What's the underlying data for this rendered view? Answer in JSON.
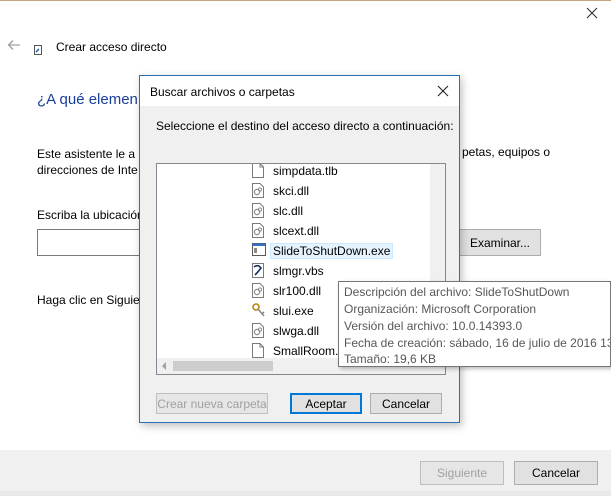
{
  "wizard": {
    "title": "Crear acceso directo",
    "heading": "¿A qué elemen",
    "description_line1": "Este asistente le a",
    "description_line1_right": "petas, equipos o",
    "description_line2": "direcciones de Inte",
    "location_label": "Escriba la ubicación",
    "location_value": "",
    "browse_button": "Examinar...",
    "hint": "Haga clic en Siguie",
    "next_button": "Siguiente",
    "cancel_button": "Cancelar"
  },
  "dialog": {
    "title": "Buscar archivos o carpetas",
    "instruction": "Seleccione el destino del acceso directo a continuación:",
    "items": [
      {
        "name": "simpdata.tlb",
        "icon": "file-icon"
      },
      {
        "name": "skci.dll",
        "icon": "dll-icon"
      },
      {
        "name": "slc.dll",
        "icon": "dll-icon"
      },
      {
        "name": "slcext.dll",
        "icon": "dll-icon"
      },
      {
        "name": "SlideToShutDown.exe",
        "icon": "exe-icon",
        "selected": true
      },
      {
        "name": "slmgr.vbs",
        "icon": "script-icon"
      },
      {
        "name": "slr100.dll",
        "icon": "dll-icon"
      },
      {
        "name": "slui.exe",
        "icon": "key-icon"
      },
      {
        "name": "slwga.dll",
        "icon": "dll-icon"
      },
      {
        "name": "SmallRoom.b",
        "icon": "file-icon"
      }
    ],
    "new_folder_button": "Crear nueva carpeta",
    "ok_button": "Aceptar",
    "cancel_button": "Cancelar"
  },
  "tooltip": {
    "description": "Descripción del archivo: SlideToShutDown",
    "organization": "Organización: Microsoft Corporation",
    "version": "Versión del archivo: 10.0.14393.0",
    "created": "Fecha de creación: sábado, 16 de julio de 2016 13:",
    "size": "Tamaño: 19,6 KB"
  },
  "colors": {
    "accent": "#0078d7",
    "heading": "#1a3e9c",
    "dialog_border": "#2b6fb5",
    "footer": "#f0f0f0"
  }
}
